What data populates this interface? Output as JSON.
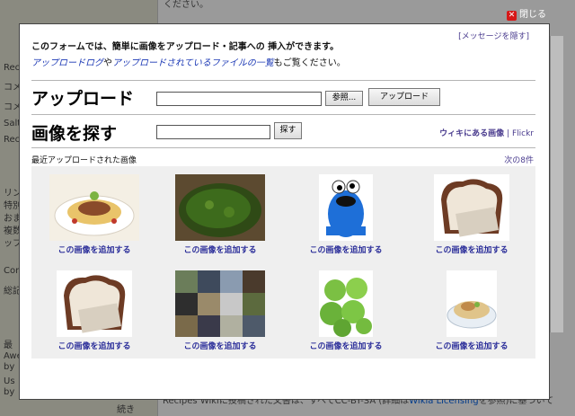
{
  "background": {
    "top_text": "ください。",
    "sidebar_lines": [
      "Rec",
      "コメ",
      "コメ",
      "Salt",
      "Rec",
      "リン",
      "特別",
      "おま",
      "複数",
      "ッフ",
      "Cor",
      "総記",
      "最",
      "Awe",
      "by",
      "Us",
      "by"
    ],
    "bottom_prefix": "Recipes Wikiに投稿された文書は、すべてCC-BY-SA (詳細は",
    "bottom_link": "Wikia Licensing",
    "bottom_suffix": "を参照)に基づいて",
    "continue": "続き"
  },
  "close": {
    "label": "閉じる"
  },
  "modal": {
    "hide_message": "[メッセージを隠す]",
    "intro": "このフォームでは、簡単に画像をアップロード・記事への 挿入ができます。",
    "upload_log_link": "アップロードログ",
    "intro_mid": "や",
    "uploaded_files_link": "アップロードされているファイルの一覧",
    "intro_end": "もご覧ください。",
    "upload_heading": "アップロード",
    "browse_label": "参照...",
    "upload_button": "アップロード",
    "find_heading": "画像を探す",
    "search_button": "探す",
    "wiki_images_link": "ウィキにある画像",
    "separator": "|",
    "flickr_link": "Flickr",
    "recent_label": "最近アップロードされた画像",
    "next_link": "次の8件",
    "images": [
      {
        "alt": "pasta",
        "add_label": "この画像を追加する"
      },
      {
        "alt": "green-curry",
        "add_label": "この画像を追加する"
      },
      {
        "alt": "cookie-monster",
        "add_label": "この画像を追加する"
      },
      {
        "alt": "bread-slice",
        "add_label": "この画像を追加する"
      },
      {
        "alt": "bread-slice-2",
        "add_label": "この画像を追加する"
      },
      {
        "alt": "collage",
        "add_label": "この画像を追加する"
      },
      {
        "alt": "green-apples",
        "add_label": "この画像を追加する"
      },
      {
        "alt": "noodle-dish",
        "add_label": "この画像を追加する"
      }
    ]
  }
}
